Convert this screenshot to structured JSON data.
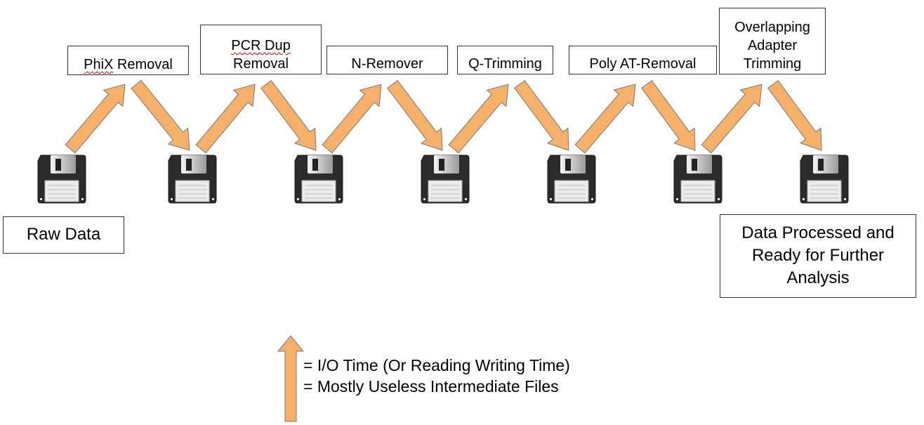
{
  "diagram": {
    "arrow_color": "#f5b06a",
    "arrow_stroke": "#7a7a7a",
    "steps": [
      {
        "label": "PhiX Removal",
        "spellcheck_word": "PhiX"
      },
      {
        "label": "PCR Dup\nRemoval",
        "spellcheck_word": "PCR Dup"
      },
      {
        "label": "N-Remover"
      },
      {
        "label": "Q-Trimming"
      },
      {
        "label": "Poly AT-Removal"
      },
      {
        "label": "Overlapping\nAdapter\nTrimming"
      }
    ],
    "start_label": "Raw Data",
    "end_label": "Data Processed and\nReady for Further\nAnalysis",
    "file_icon_count": 7
  },
  "legend": {
    "arrow_meaning": "= I/O Time (Or Reading Writing Time)",
    "file_meaning": "= Mostly Useless Intermediate Files"
  }
}
